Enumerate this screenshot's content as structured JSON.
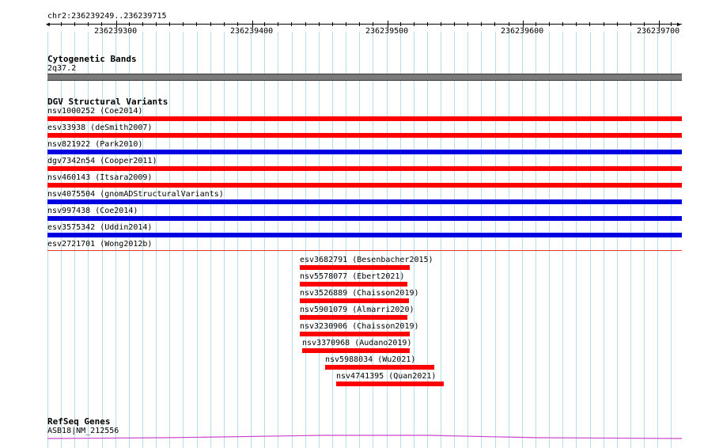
{
  "ruler": {
    "location": "chr2:236239249..236239715",
    "ticks": [
      "236239300",
      "236239400",
      "236239500",
      "236239600",
      "236239700"
    ]
  },
  "cytoband": {
    "title": "Cytogenetic Bands",
    "band": "2q37.2",
    "color": "#7a7a7a"
  },
  "dgv": {
    "title": "DGV Structural Variants",
    "full_span_items": [
      {
        "label": "nsv1000252 (Coe2014)",
        "color": "#ff0000"
      },
      {
        "label": "esv33938 (deSmith2007)",
        "color": "#ff0000"
      },
      {
        "label": "nsv821922 (Park2010)",
        "color": "#0000e0"
      },
      {
        "label": "dgv7342n54 (Cooper2011)",
        "color": "#ff0000"
      },
      {
        "label": "nsv460143 (Itsara2009)",
        "color": "#ff0000"
      },
      {
        "label": "nsv4075504 (gnomADStructuralVariants)",
        "color": "#0000e0"
      },
      {
        "label": "nsv997438 (Coe2014)",
        "color": "#0000e0"
      },
      {
        "label": "esv3575342 (Uddin2014)",
        "color": "#0000e0"
      },
      {
        "label": "esv2721701 (Wong2012b)",
        "color": "#ff0000"
      }
    ],
    "partial_items": [
      {
        "label": "esv3682791 (Besenbacher2015)",
        "color": "#ff0000"
      },
      {
        "label": "nsv5578077 (Ebert2021)",
        "color": "#ff0000"
      },
      {
        "label": "nsv3526889 (Chaisson2019)",
        "color": "#ff0000"
      },
      {
        "label": "nsv5901079 (Almarri2020)",
        "color": "#ff0000"
      },
      {
        "label": "nsv3230906 (Chaisson2019)",
        "color": "#ff0000"
      },
      {
        "label": "nsv3370968 (Audano2019)",
        "color": "#ff0000"
      },
      {
        "label": "nsv5988034 (Wu2021)",
        "color": "#ff0000"
      },
      {
        "label": "nsv4741395 (Quan2021)",
        "color": "#ff0000"
      }
    ]
  },
  "refseq": {
    "title": "RefSeq Genes",
    "gene": "ASB18|NM_212556",
    "color": "#cc44cc"
  },
  "colors": {
    "gridline": "#b9dcec",
    "loss": "#ff0000",
    "gain": "#0000e0"
  }
}
